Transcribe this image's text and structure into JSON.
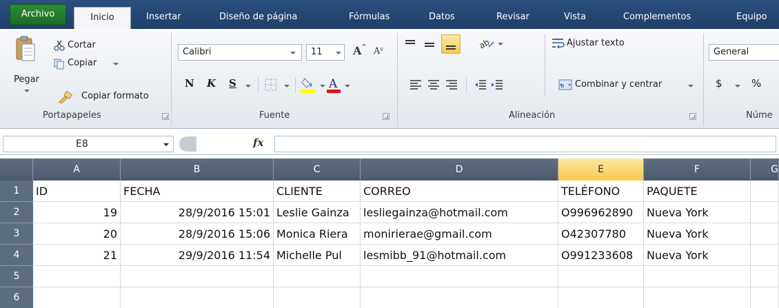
{
  "tabs": [
    "Archivo",
    "Inicio",
    "Insertar",
    "Diseño de página",
    "Fórmulas",
    "Datos",
    "Revisar",
    "Vista",
    "Complementos",
    "Equipo"
  ],
  "ribbon": {
    "clipboard": {
      "paste": "Pegar",
      "cut": "Cortar",
      "copy": "Copiar",
      "format_painter": "Copiar formato",
      "label": "Portapapeles"
    },
    "font": {
      "name": "Calibri",
      "size": "11",
      "bold": "N",
      "italic": "K",
      "underline": "S",
      "label": "Fuente"
    },
    "alignment": {
      "wrap": "Ajustar texto",
      "merge": "Combinar y centrar",
      "label": "Alineación"
    },
    "number": {
      "format": "General",
      "currency": "$",
      "percent": "%",
      "label": "Núme"
    }
  },
  "formula_bar": {
    "name_box": "E8",
    "fx": "fx",
    "value": ""
  },
  "columns": [
    "A",
    "B",
    "C",
    "D",
    "E",
    "F",
    "G"
  ],
  "selected_column": "E",
  "rows": [
    "1",
    "2",
    "3",
    "4",
    "5",
    "6"
  ],
  "cells": [
    [
      "ID",
      "FECHA",
      "CLIENTE",
      "CORREO",
      "TELÉFONO",
      "PAQUETE",
      ""
    ],
    [
      "19",
      "28/9/2016 15:01",
      "Leslie Gainza",
      "lesliegainza@hotmail.com",
      "O996962890",
      "Nueva York",
      ""
    ],
    [
      "20",
      "28/9/2016 15:06",
      "Monica Riera",
      "monirierae@gmail.com",
      "O42307780",
      "Nueva York",
      ""
    ],
    [
      "21",
      "29/9/2016 11:54",
      "Michelle Pul",
      "lesmibb_91@hotmail.com",
      "O991233608",
      "Nueva York",
      ""
    ],
    [
      "",
      "",
      "",
      "",
      "",
      "",
      ""
    ],
    [
      "",
      "",
      "",
      "",
      "",
      "",
      ""
    ]
  ],
  "colors": {
    "archivo": "#1f7a2a",
    "tabbar": "#2b4f7e",
    "header": "#5b6b7d",
    "selected_header": "#f8d46a"
  }
}
